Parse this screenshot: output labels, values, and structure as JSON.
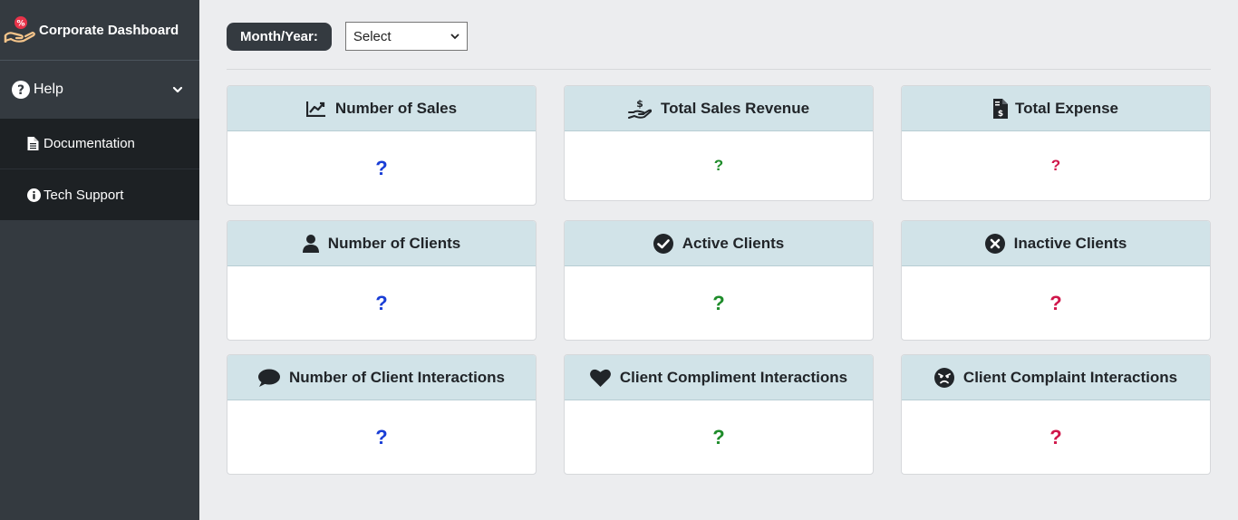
{
  "sidebar": {
    "brand": {
      "title": "Corporate Dashboard",
      "logo_icon": "hand-coin-icon"
    },
    "help": {
      "label": "Help",
      "icon": "question-circle-icon",
      "chevron": "chevron-down-icon"
    },
    "items": [
      {
        "label": "Documentation",
        "icon": "file-icon"
      },
      {
        "label": "Tech Support",
        "icon": "info-circle-icon"
      }
    ]
  },
  "filter": {
    "label": "Month/Year:",
    "select_value": "Select"
  },
  "colors": {
    "sidebar_bg": "#343a40",
    "submenu_bg": "#1d2124",
    "card_header_bg": "#d1e3e8",
    "value_blue": "#1a3ed6",
    "value_green": "#1e8c2a",
    "value_red": "#d0164a"
  },
  "cards": [
    {
      "title": "Number of Sales",
      "icon": "chart-line-icon",
      "value": "?"
    },
    {
      "title": "Total Sales Revenue",
      "icon": "hand-holding-dollar-icon",
      "value": "?"
    },
    {
      "title": "Total Expense",
      "icon": "file-invoice-dollar-icon",
      "value": "?"
    },
    {
      "title": "Number of Clients",
      "icon": "user-icon",
      "value": "?"
    },
    {
      "title": "Active Clients",
      "icon": "check-circle-icon",
      "value": "?"
    },
    {
      "title": "Inactive Clients",
      "icon": "times-circle-icon",
      "value": "?"
    },
    {
      "title": "Number of Client Interactions",
      "icon": "comment-icon",
      "value": "?"
    },
    {
      "title": "Client Compliment Interactions",
      "icon": "heart-icon",
      "value": "?"
    },
    {
      "title": "Client Complaint Interactions",
      "icon": "angry-face-icon",
      "value": "?"
    }
  ]
}
